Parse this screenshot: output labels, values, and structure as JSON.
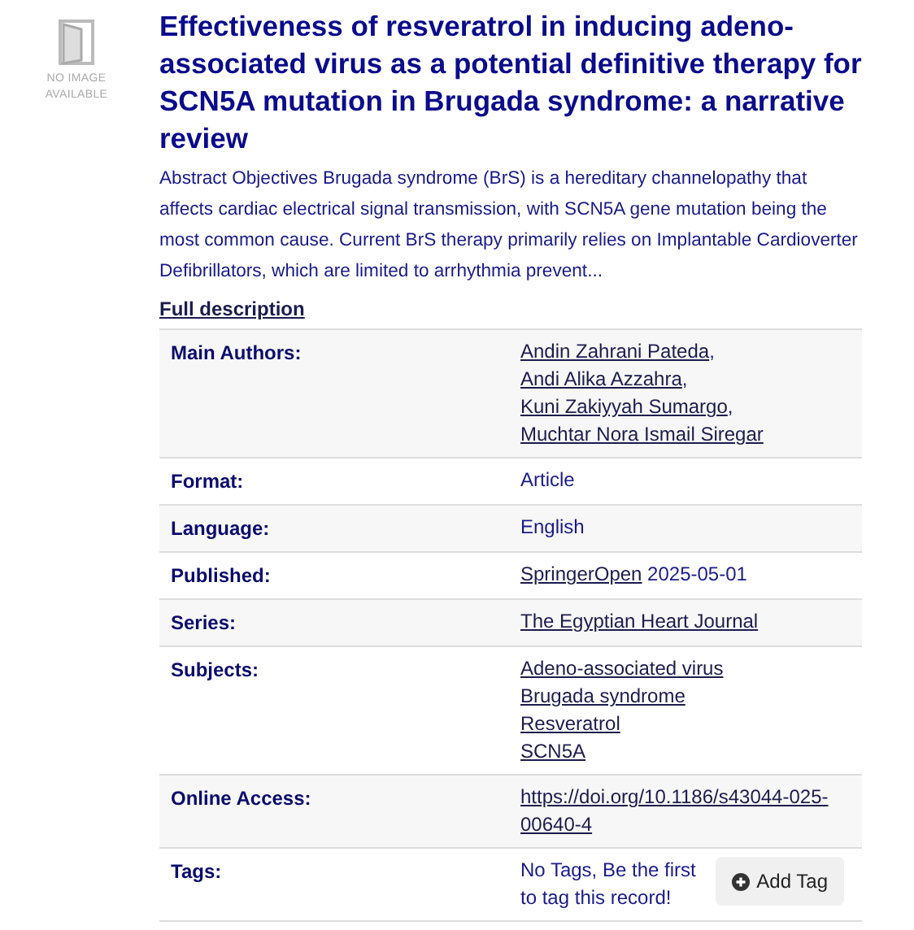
{
  "thumbnail": {
    "caption_lines": [
      "NO IMAGE",
      "AVAILABLE"
    ]
  },
  "title": "Effectiveness of resveratrol in inducing adeno-associated virus as a potential definitive therapy for SCN5A mutation in Brugada syndrome: a narrative review",
  "abstract": "Abstract Objectives Brugada syndrome (BrS) is a hereditary channelopathy that affects cardiac electrical signal transmission, with SCN5A gene mutation being the most common cause. Current BrS therapy primarily relies on Implantable Cardioverter Defibrillators, which are limited to arrhythmia prevent...",
  "full_description_link": "Full description",
  "details": [
    {
      "label": "Main Authors:",
      "kind": "inline",
      "parts": [
        {
          "text": "Andin Zahrani Pateda",
          "link": true
        },
        {
          "text": ", ",
          "link": false
        },
        {
          "text": "Andi Alika Azzahra",
          "link": true
        },
        {
          "text": ", ",
          "link": false
        },
        {
          "text": "Kuni Zakiyyah Sumargo",
          "link": true
        },
        {
          "text": ", ",
          "link": false
        },
        {
          "text": "Muchtar Nora Ismail Siregar",
          "link": true
        }
      ]
    },
    {
      "label": "Format:",
      "kind": "inline",
      "parts": [
        {
          "text": "Article",
          "link": false
        }
      ]
    },
    {
      "label": "Language:",
      "kind": "inline",
      "parts": [
        {
          "text": "English",
          "link": false
        }
      ]
    },
    {
      "label": "Published:",
      "kind": "inline",
      "parts": [
        {
          "text": "SpringerOpen",
          "link": true
        },
        {
          "text": " 2025-05-01",
          "link": false
        }
      ]
    },
    {
      "label": "Series:",
      "kind": "inline",
      "parts": [
        {
          "text": "The Egyptian Heart Journal",
          "link": true
        }
      ]
    },
    {
      "label": "Subjects:",
      "kind": "list",
      "parts": [
        {
          "text": "Adeno-associated virus",
          "link": true
        },
        {
          "text": "Brugada syndrome",
          "link": true
        },
        {
          "text": "Resveratrol",
          "link": true
        },
        {
          "text": "SCN5A",
          "link": true
        }
      ]
    },
    {
      "label": "Online Access:",
      "kind": "inline",
      "parts": [
        {
          "text": "https://doi.org/10.1186/s43044-025-00640-4",
          "link": true
        }
      ]
    },
    {
      "label": "Tags:",
      "kind": "tags",
      "note": "No Tags, Be the first to tag this record!",
      "button": "Add Tag"
    }
  ]
}
